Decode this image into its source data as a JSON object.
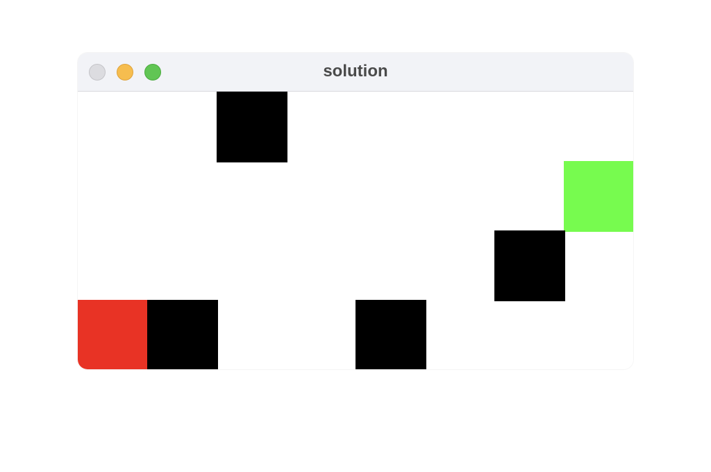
{
  "window": {
    "title": "solution",
    "buttons": [
      "close-button",
      "minimize-button",
      "zoom-button"
    ]
  },
  "board": {
    "columns": 8,
    "rows": 4,
    "colors": {
      "wall": "#000000",
      "player": "#e83325",
      "goal": "#77fb4f",
      "empty": "#ffffff"
    },
    "cells": [
      {
        "type": "wall",
        "col": 2,
        "row": 0
      },
      {
        "type": "goal",
        "col": 7,
        "row": 1
      },
      {
        "type": "wall",
        "col": 6,
        "row": 2
      },
      {
        "type": "player",
        "col": 0,
        "row": 3
      },
      {
        "type": "wall",
        "col": 1,
        "row": 3
      },
      {
        "type": "wall",
        "col": 4,
        "row": 3
      }
    ]
  }
}
